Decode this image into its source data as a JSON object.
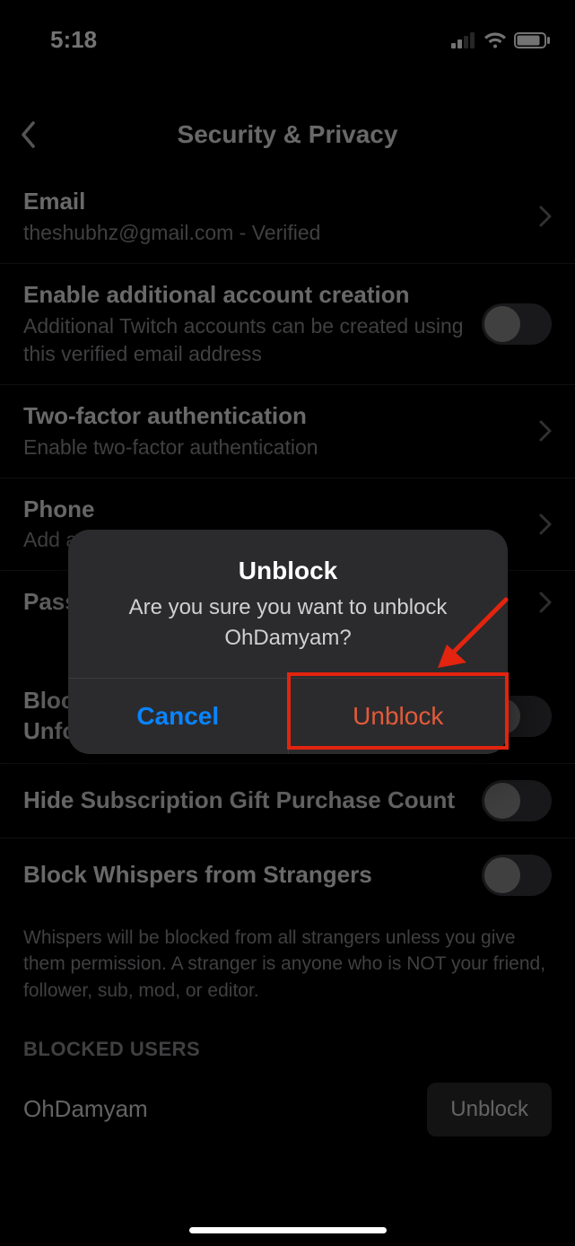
{
  "status_bar": {
    "time": "5:18"
  },
  "nav": {
    "title": "Security & Privacy"
  },
  "rows": {
    "email": {
      "title": "Email",
      "sub": "theshubhz@gmail.com - Verified"
    },
    "addacct": {
      "title": "Enable additional account creation",
      "sub": "Additional Twitch accounts can be created using this verified email address"
    },
    "twofa": {
      "title": "Two-factor authentication",
      "sub": "Enable two-factor authentication"
    },
    "phone": {
      "title": "Phone",
      "sub": "Add a"
    },
    "password": {
      "title": "Passw"
    },
    "blockgift": {
      "title": "Block Gift Subscriptions from Unfollowed Channels"
    },
    "hidesub": {
      "title": "Hide Subscription Gift Purchase Count"
    },
    "blockwhisper": {
      "title": "Block Whispers from Strangers"
    }
  },
  "footer_note": "Whispers will be blocked from all strangers unless you give them permission. A stranger is anyone who is NOT your friend, follower, sub, mod, or editor.",
  "section_header": "BLOCKED USERS",
  "blocked_user": {
    "name": "OhDamyam",
    "button": "Unblock"
  },
  "modal": {
    "title": "Unblock",
    "message": "Are you sure you want to unblock OhDamyam?",
    "cancel": "Cancel",
    "confirm": "Unblock"
  }
}
